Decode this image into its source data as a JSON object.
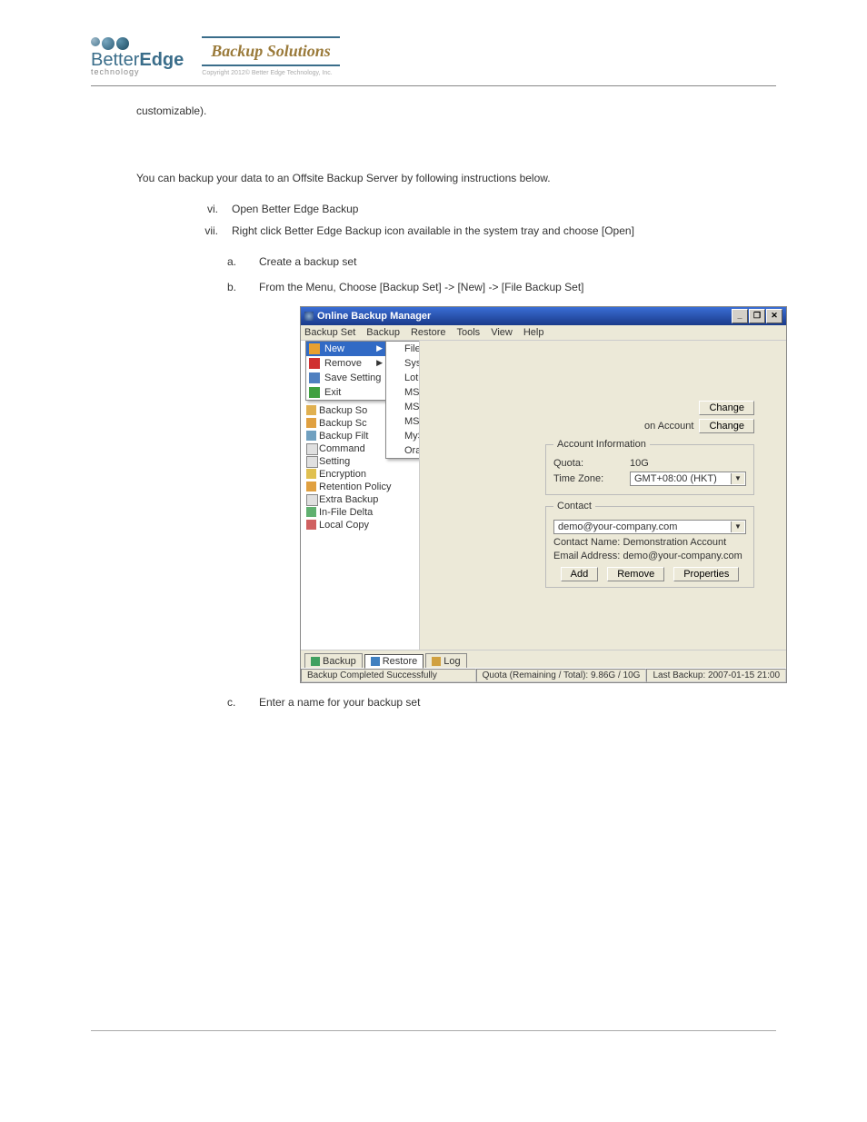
{
  "header": {
    "logo_better": "Better",
    "logo_edge": "Edge",
    "logo_tech": "technology",
    "backup_solutions": "Backup Solutions",
    "copyright": "Copyright 2012©\nBetter Edge Technology, Inc."
  },
  "doc": {
    "p1": "customizable).",
    "p2": "You can backup your data to an Offsite Backup Server by following instructions below.",
    "roman": [
      {
        "num": "vi.",
        "text": "Open Better Edge Backup"
      },
      {
        "num": "vii.",
        "text": "Right click Better Edge Backup icon available in the system tray and choose [Open]"
      }
    ],
    "alpha": [
      {
        "lt": "a.",
        "text": "Create a backup set"
      },
      {
        "lt": "b.",
        "text": "From the Menu, Choose [Backup Set] -> [New] -> [File Backup Set]"
      },
      {
        "lt": "c.",
        "text": "Enter a name for your backup set"
      }
    ]
  },
  "app": {
    "title": "Online Backup Manager",
    "menus": [
      "Backup Set",
      "Backup",
      "Restore",
      "Tools",
      "View",
      "Help"
    ],
    "dropdown": {
      "items": [
        {
          "label": "New",
          "hl": true,
          "arrow": true,
          "icon": "#e8a030"
        },
        {
          "label": "Remove",
          "arrow": true,
          "icon": "#d03030"
        },
        {
          "label": "Save Setting",
          "icon": "#5080c0"
        },
        {
          "label": "Exit",
          "icon": "#40a040"
        }
      ]
    },
    "submenu": [
      {
        "label": "File Backup Set",
        "icon": "#e8a030"
      },
      {
        "label": "System State Backup Set",
        "icon": "#d8a010"
      },
      {
        "label": "Lotus Backup Set",
        "icon": "#e8c050"
      },
      {
        "label": "MS Exchange Backup Set",
        "icon": "#4080c0"
      },
      {
        "label": "MS Exchange Mail Level Backup Set",
        "icon": "#60a0d0"
      },
      {
        "label": "MS SQL Server Backup Set",
        "icon": "#a05050"
      },
      {
        "label": "MySQL Backup Set",
        "icon": "#50a090"
      },
      {
        "label": "Oracle Database Backup Set",
        "icon": "#d04040"
      }
    ],
    "tree": [
      {
        "label": "Backup So",
        "icon": "#e0b050"
      },
      {
        "label": "Backup Sc",
        "icon": "#e0a040"
      },
      {
        "label": "Backup Filt",
        "icon": "#70a0c0"
      },
      {
        "label": "Command",
        "icon": "#e0e0e0"
      },
      {
        "label": "Setting",
        "icon": "#e0e0e0"
      },
      {
        "label": "Encryption",
        "icon": "#e0c050"
      },
      {
        "label": "Retention Policy",
        "icon": "#e0a040"
      },
      {
        "label": "Extra Backup",
        "icon": "#e0e0e0"
      },
      {
        "label": "In-File Delta",
        "icon": "#60b070"
      },
      {
        "label": "Local Copy",
        "icon": "#d06060"
      }
    ],
    "right": {
      "change": "Change",
      "account_lbl": "on Account",
      "fs": {
        "legend1": "Account Information",
        "quota_lbl": "Quota:",
        "quota_val": "10G",
        "tz_lbl": "Time Zone:",
        "tz_val": "GMT+08:00 (HKT)",
        "legend2": "Contact",
        "contact_sel": "demo@your-company.com",
        "cn_lbl": "Contact Name:",
        "cn_val": "Demonstration Account",
        "em_lbl": "Email Address:",
        "em_val": "demo@your-company.com",
        "add": "Add",
        "remove": "Remove",
        "props": "Properties"
      }
    },
    "tabs": [
      {
        "label": "Backup",
        "icon": "#40a060"
      },
      {
        "label": "Restore",
        "sel": true,
        "icon": "#4080c0"
      },
      {
        "label": "Log",
        "icon": "#d0a040"
      }
    ],
    "status": {
      "msg": "Backup Completed Successfully",
      "quota": "Quota (Remaining / Total): 9.86G / 10G",
      "last": "Last Backup: 2007-01-15 21:00"
    }
  }
}
